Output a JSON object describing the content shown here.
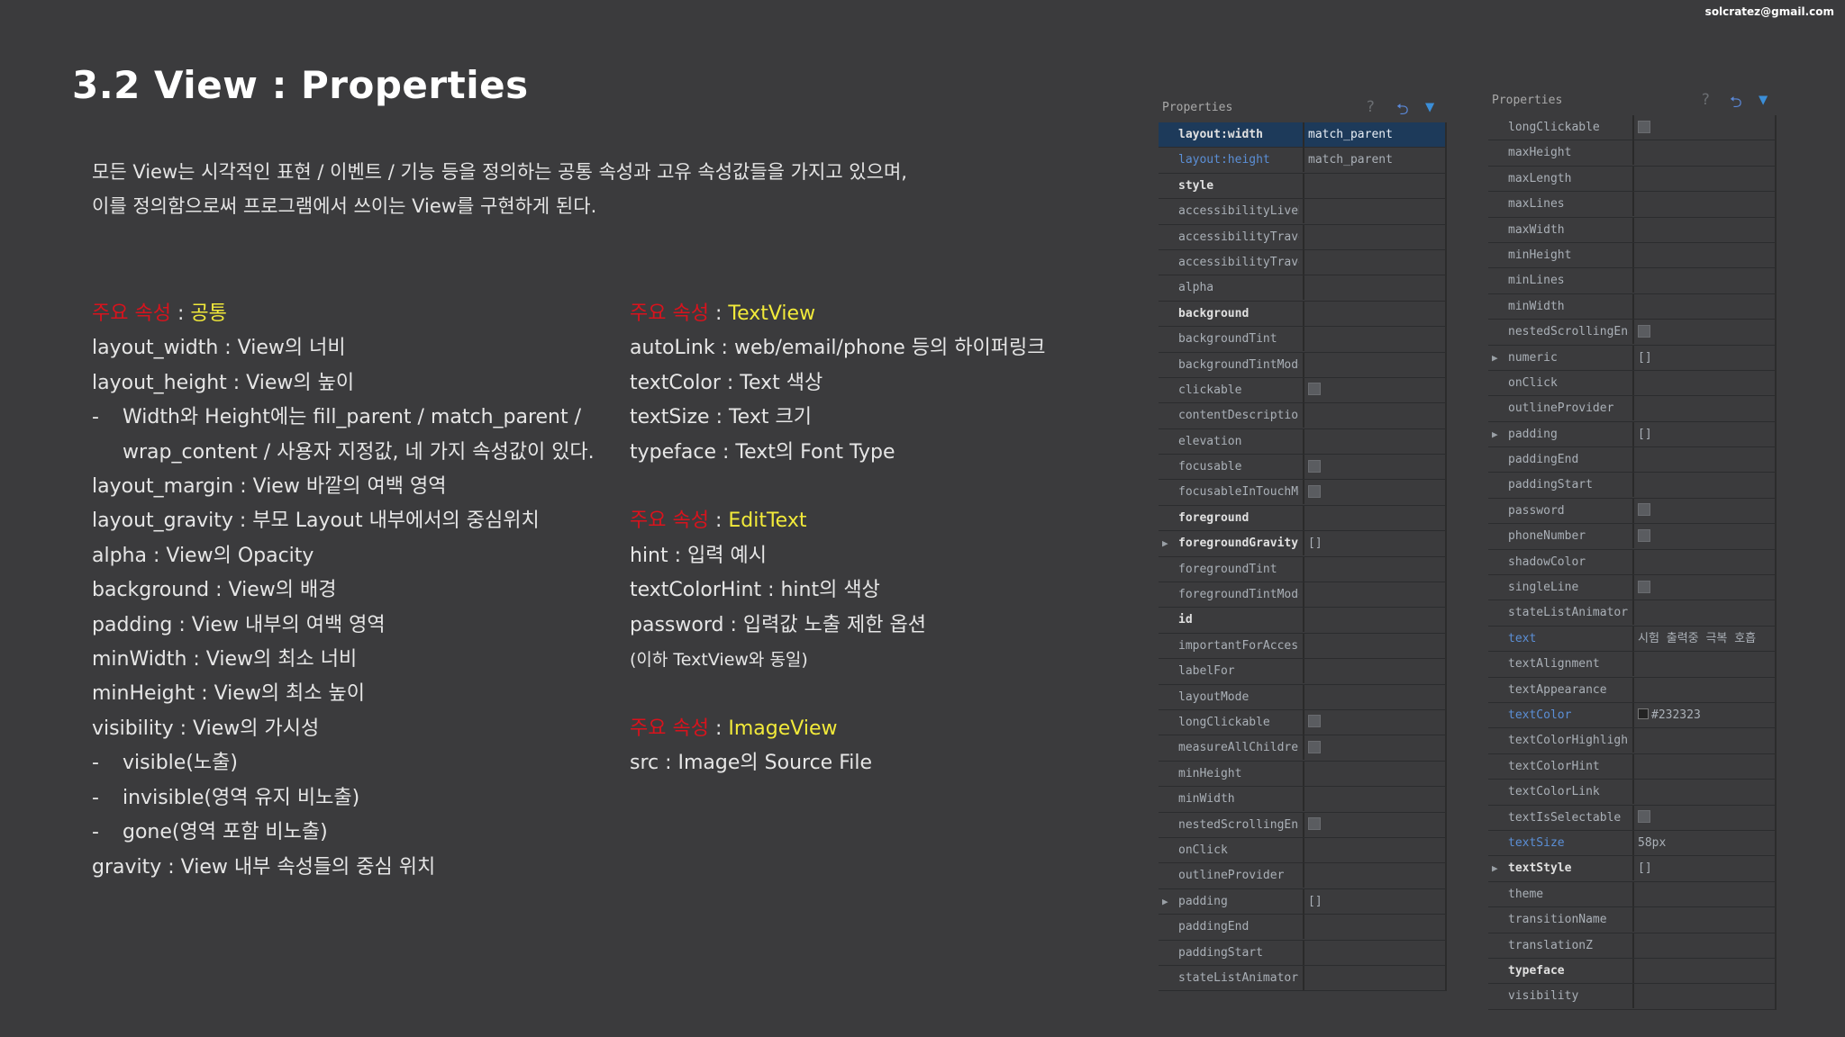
{
  "email": "solcratez@gmail.com",
  "title": "3.2 View : Properties",
  "intro": [
    "모든 View는 시각적인 표현 / 이벤트 / 기능 등을 정의하는 공통 속성과 고유 속성값들을 가지고 있으며,",
    "이를 정의함으로써 프로그램에서 쓰이는 View를 구현하게 된다."
  ],
  "col1": {
    "header": {
      "red": "주요 속성",
      "sep": " : ",
      "yellow": "공통"
    },
    "lines": [
      {
        "text": "layout_width : View의 너비",
        "kind": "normal"
      },
      {
        "text": "layout_height : View의 높이",
        "kind": "normal"
      },
      {
        "text": "Width와 Height에는 fill_parent / match_parent /",
        "kind": "dash"
      },
      {
        "text": "wrap_content / 사용자 지정값, 네 가지 속성값이 있다.",
        "kind": "cont"
      },
      {
        "text": "layout_margin : View 바깥의 여백 영역",
        "kind": "normal"
      },
      {
        "text": "layout_gravity : 부모 Layout 내부에서의 중심위치",
        "kind": "normal"
      },
      {
        "text": "alpha : View의 Opacity",
        "kind": "normal"
      },
      {
        "text": "background : View의 배경",
        "kind": "normal"
      },
      {
        "text": "padding : View 내부의 여백 영역",
        "kind": "normal"
      },
      {
        "text": "minWidth : View의 최소 너비",
        "kind": "normal"
      },
      {
        "text": "minHeight : View의 최소 높이",
        "kind": "normal"
      },
      {
        "text": "visibility : View의 가시성",
        "kind": "normal"
      },
      {
        "text": "visible(노출)",
        "kind": "dash"
      },
      {
        "text": "invisible(영역 유지 비노출)",
        "kind": "dash"
      },
      {
        "text": "gone(영역 포함 비노출)",
        "kind": "dash"
      },
      {
        "text": "gravity : View 내부 속성들의 중심 위치",
        "kind": "normal"
      }
    ]
  },
  "col2": {
    "sections": [
      {
        "header": {
          "red": "주요 속성",
          "sep": " : ",
          "yellow": "TextView"
        },
        "lines": [
          {
            "text": "autoLink : web/email/phone 등의 하이퍼링크",
            "kind": "normal"
          },
          {
            "text": "textColor : Text 색상",
            "kind": "normal"
          },
          {
            "text": "textSize : Text 크기",
            "kind": "normal"
          },
          {
            "text": "typeface : Text의 Font Type",
            "kind": "normal"
          }
        ]
      },
      {
        "header": {
          "red": "주요 속성",
          "sep": " : ",
          "yellow": "EditText"
        },
        "lines": [
          {
            "text": "hint : 입력 예시",
            "kind": "normal"
          },
          {
            "text": "textColorHint : hint의 색상",
            "kind": "normal"
          },
          {
            "text": "password : 입력값 노출 제한 옵션",
            "kind": "normal"
          },
          {
            "text": "(이하 TextView와 동일)",
            "kind": "small"
          }
        ]
      },
      {
        "header": {
          "red": "주요 속성",
          "sep": " : ",
          "yellow": "ImageView"
        },
        "lines": [
          {
            "text": "src : Image의 Source File",
            "kind": "normal"
          }
        ]
      }
    ]
  },
  "panel1": {
    "title": "Properties",
    "icons": [
      "help-icon",
      "undo-icon",
      "filter-icon"
    ],
    "rows": [
      {
        "name": "layout:width",
        "value": "match_parent",
        "style": "bold",
        "selected": true
      },
      {
        "name": "layout:height",
        "value": "match_parent",
        "style": "blue"
      },
      {
        "name": "style",
        "value": "",
        "style": "bold"
      },
      {
        "name": "accessibilityLiveRegion",
        "value": ""
      },
      {
        "name": "accessibilityTraversalAfter",
        "value": ""
      },
      {
        "name": "accessibilityTraversalBefore",
        "value": ""
      },
      {
        "name": "alpha",
        "value": ""
      },
      {
        "name": "background",
        "value": "",
        "style": "bold"
      },
      {
        "name": "backgroundTint",
        "value": ""
      },
      {
        "name": "backgroundTintMode",
        "value": ""
      },
      {
        "name": "clickable",
        "value": "",
        "checkbox": true
      },
      {
        "name": "contentDescription",
        "value": ""
      },
      {
        "name": "elevation",
        "value": ""
      },
      {
        "name": "focusable",
        "value": "",
        "checkbox": true
      },
      {
        "name": "focusableInTouchMode",
        "value": "",
        "checkbox": true
      },
      {
        "name": "foreground",
        "value": "",
        "style": "bold"
      },
      {
        "name": "foregroundGravity",
        "value": "[]",
        "style": "bold",
        "expand": true
      },
      {
        "name": "foregroundTint",
        "value": ""
      },
      {
        "name": "foregroundTintMode",
        "value": ""
      },
      {
        "name": "id",
        "value": "",
        "style": "bold"
      },
      {
        "name": "importantForAccessibility",
        "value": ""
      },
      {
        "name": "labelFor",
        "value": ""
      },
      {
        "name": "layoutMode",
        "value": ""
      },
      {
        "name": "longClickable",
        "value": "",
        "checkbox": true
      },
      {
        "name": "measureAllChildren",
        "value": "",
        "checkbox": true
      },
      {
        "name": "minHeight",
        "value": ""
      },
      {
        "name": "minWidth",
        "value": ""
      },
      {
        "name": "nestedScrollingEnabled",
        "value": "",
        "checkbox": true
      },
      {
        "name": "onClick",
        "value": ""
      },
      {
        "name": "outlineProvider",
        "value": ""
      },
      {
        "name": "padding",
        "value": "[]",
        "expand": true
      },
      {
        "name": "paddingEnd",
        "value": ""
      },
      {
        "name": "paddingStart",
        "value": ""
      },
      {
        "name": "stateListAnimator",
        "value": ""
      }
    ]
  },
  "panel2": {
    "title": "Properties",
    "icons": [
      "help-icon",
      "undo-icon",
      "filter-icon"
    ],
    "rows": [
      {
        "name": "longClickable",
        "value": "",
        "checkbox": true
      },
      {
        "name": "maxHeight",
        "value": ""
      },
      {
        "name": "maxLength",
        "value": ""
      },
      {
        "name": "maxLines",
        "value": ""
      },
      {
        "name": "maxWidth",
        "value": ""
      },
      {
        "name": "minHeight",
        "value": ""
      },
      {
        "name": "minLines",
        "value": ""
      },
      {
        "name": "minWidth",
        "value": ""
      },
      {
        "name": "nestedScrollingEnabled",
        "value": "",
        "checkbox": true
      },
      {
        "name": "numeric",
        "value": "[]",
        "expand": true
      },
      {
        "name": "onClick",
        "value": ""
      },
      {
        "name": "outlineProvider",
        "value": ""
      },
      {
        "name": "padding",
        "value": "[]",
        "expand": true
      },
      {
        "name": "paddingEnd",
        "value": ""
      },
      {
        "name": "paddingStart",
        "value": ""
      },
      {
        "name": "password",
        "value": "",
        "checkbox": true
      },
      {
        "name": "phoneNumber",
        "value": "",
        "checkbox": true
      },
      {
        "name": "shadowColor",
        "value": ""
      },
      {
        "name": "singleLine",
        "value": "",
        "checkbox": true
      },
      {
        "name": "stateListAnimator",
        "value": ""
      },
      {
        "name": "text",
        "value": "시험 출력중 극복 호흡",
        "style": "blue"
      },
      {
        "name": "textAlignment",
        "value": ""
      },
      {
        "name": "textAppearance",
        "value": ""
      },
      {
        "name": "textColor",
        "value": "#232323",
        "style": "blue",
        "swatch": "#232323"
      },
      {
        "name": "textColorHighlight",
        "value": ""
      },
      {
        "name": "textColorHint",
        "value": ""
      },
      {
        "name": "textColorLink",
        "value": ""
      },
      {
        "name": "textIsSelectable",
        "value": "",
        "checkbox": true
      },
      {
        "name": "textSize",
        "value": "58px",
        "style": "blue"
      },
      {
        "name": "textStyle",
        "value": "[]",
        "style": "bold",
        "expand": true
      },
      {
        "name": "theme",
        "value": ""
      },
      {
        "name": "transitionName",
        "value": ""
      },
      {
        "name": "translationZ",
        "value": ""
      },
      {
        "name": "typeface",
        "value": "",
        "style": "bold"
      },
      {
        "name": "visibility",
        "value": ""
      }
    ]
  }
}
